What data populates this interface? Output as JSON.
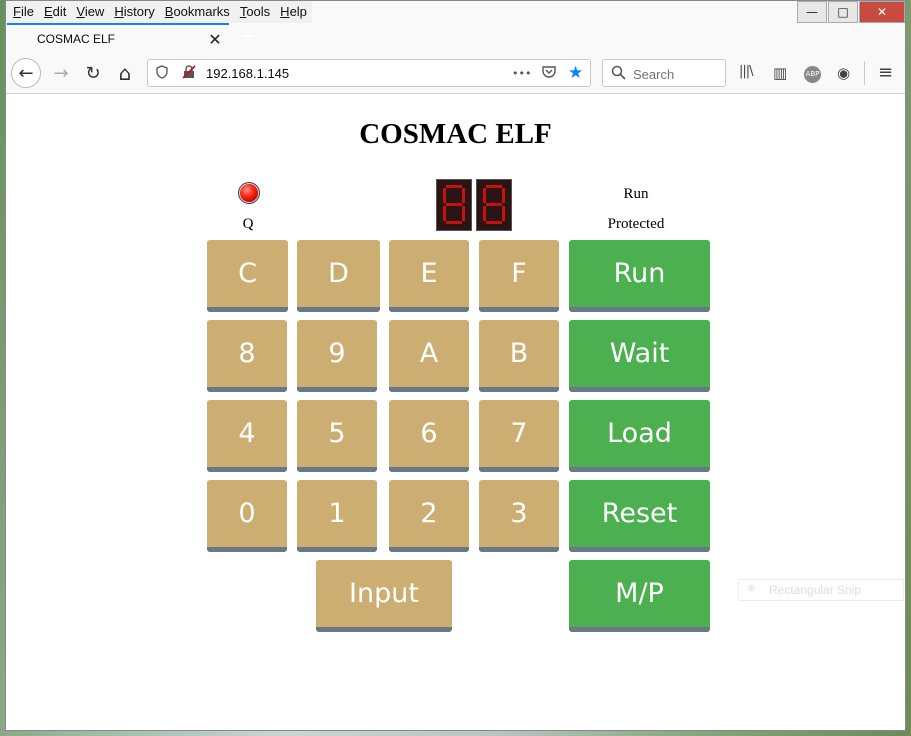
{
  "menu": {
    "items": [
      {
        "u": "F",
        "rest": "ile"
      },
      {
        "u": "E",
        "rest": "dit"
      },
      {
        "u": "V",
        "rest": "iew"
      },
      {
        "u": "H",
        "rest": "istory"
      },
      {
        "u": "B",
        "rest": "ookmarks"
      },
      {
        "u": "T",
        "rest": "ools"
      },
      {
        "u": "H",
        "rest": "elp"
      }
    ]
  },
  "window": {
    "minimize": "—",
    "maximize": "□",
    "close": "✕"
  },
  "tab": {
    "title": "COSMAC ELF",
    "close": "✕",
    "new_tab": "+"
  },
  "nav": {
    "url": "192.168.1.145",
    "search_placeholder": "Search",
    "icons": {
      "back": "←",
      "forward": "→",
      "reload": "↻",
      "home": "⌂",
      "more": "•••",
      "pocket": "◡",
      "bookmark": "★",
      "library": "|||\\",
      "sidebar": "▥",
      "adblock": "ABP",
      "account": "◉",
      "menu": "≡"
    }
  },
  "page": {
    "title": "COSMAC ELF",
    "q_label": "Q",
    "run_status": "Run",
    "protect_status": "Protected",
    "hex_keys": [
      [
        "C",
        "D",
        "E",
        "F"
      ],
      [
        "8",
        "9",
        "A",
        "B"
      ],
      [
        "4",
        "5",
        "6",
        "7"
      ],
      [
        "0",
        "1",
        "2",
        "3"
      ]
    ],
    "control_keys": [
      "Run",
      "Wait",
      "Load",
      "Reset",
      "M/P"
    ],
    "input_key": "Input",
    "colors": {
      "hex_button": "#cdae72",
      "control_button": "#4caf50",
      "led": "#ff2a1a"
    }
  },
  "overlay": {
    "snip_label": "Rectangular Snip"
  }
}
